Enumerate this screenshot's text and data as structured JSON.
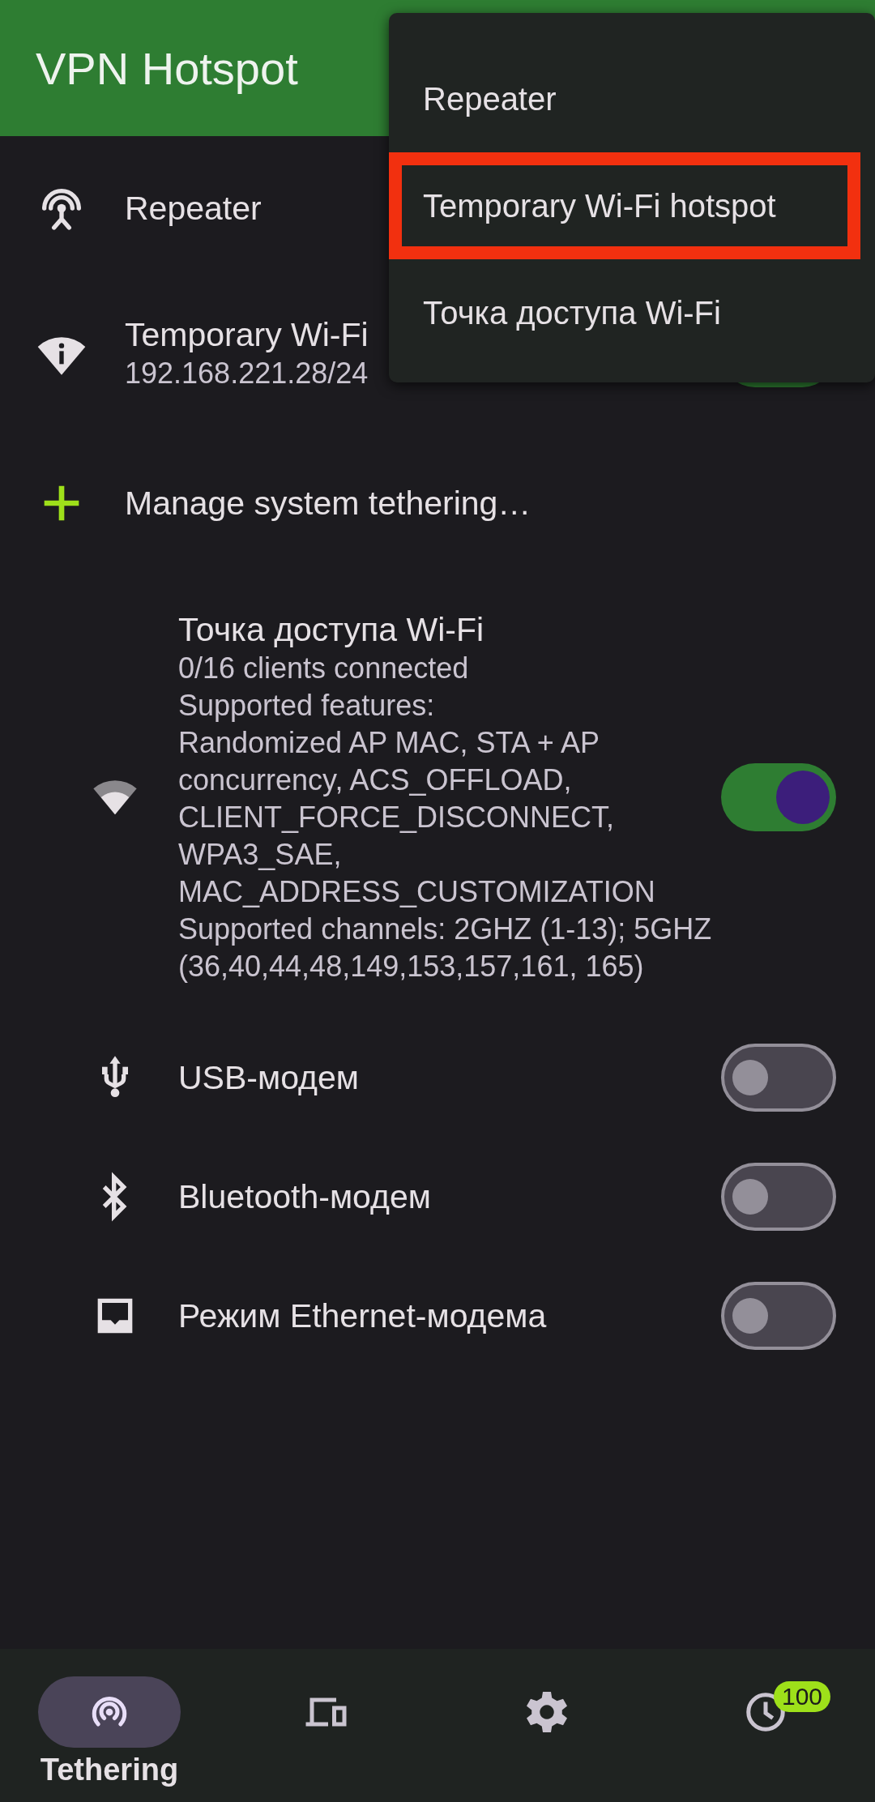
{
  "app_bar": {
    "title": "VPN Hotspot"
  },
  "list": [
    {
      "kind": "repeater",
      "title": "Repeater"
    },
    {
      "kind": "temp_hotspot",
      "title": "Temporary Wi-Fi",
      "subtitle": "192.168.221.28/24",
      "on": true
    },
    {
      "kind": "manage",
      "title": "Manage system tethering…"
    }
  ],
  "tethering": [
    {
      "kind": "wifi",
      "title": "Точка доступа Wi-Fi",
      "details": [
        "0/16 clients connected",
        "Supported features:",
        "Randomized AP MAC, STA + AP concurrency, ACS_OFFLOAD, CLIENT_FORCE_DISCONNECT, WPA3_SAE, MAC_ADDRESS_CUSTOMIZATION",
        "Supported channels: 2GHZ (1-13); 5GHZ (36,40,44,48,149,153,157,161, 165)"
      ],
      "on": true
    },
    {
      "kind": "usb",
      "title": "USB-модем",
      "on": false
    },
    {
      "kind": "bluetooth",
      "title": "Bluetooth-модем",
      "on": false
    },
    {
      "kind": "ethernet",
      "title": "Режим Ethernet-модема",
      "on": false
    }
  ],
  "menu": [
    {
      "label": "Repeater",
      "selected": false
    },
    {
      "label": "Temporary Wi-Fi hotspot",
      "selected": true
    },
    {
      "label": "Точка доступа Wi-Fi",
      "selected": false
    }
  ],
  "nav": [
    {
      "kind": "tethering",
      "label": "Tethering",
      "selected": true
    },
    {
      "kind": "clients",
      "selected": false
    },
    {
      "kind": "settings",
      "selected": false
    },
    {
      "kind": "history",
      "badge": "100",
      "selected": false
    }
  ]
}
